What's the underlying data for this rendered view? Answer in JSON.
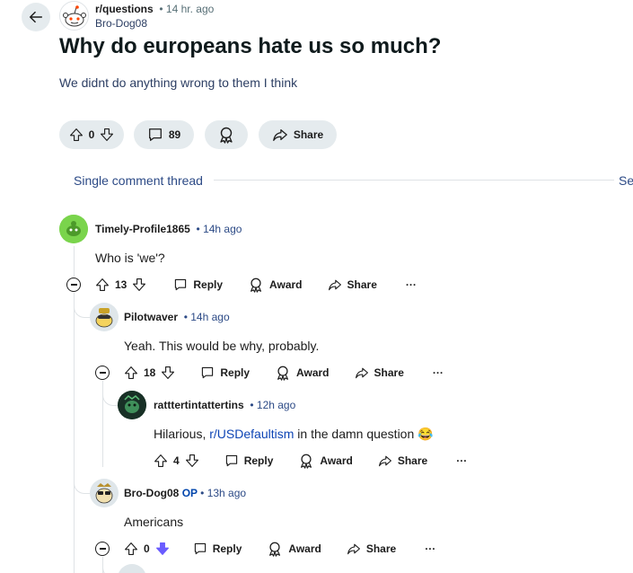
{
  "post": {
    "subreddit": "r/questions",
    "time": "14 hr. ago",
    "author": "Bro-Dog08",
    "title": "Why do europeans hate us so much?",
    "body": "We didnt do anything wrong to them I think",
    "score": "0",
    "comments_count": "89",
    "share_label": "Share"
  },
  "thread": {
    "label": "Single comment thread",
    "see_label": "Se"
  },
  "comments": [
    {
      "author": "Timely-Profile1865",
      "time": "14h ago",
      "text": "Who is 'we'?",
      "score": "13",
      "reply": "Reply",
      "award": "Award",
      "share": "Share",
      "more": "···"
    },
    {
      "author": "Pilotwaver",
      "time": "14h ago",
      "text": "Yeah. This would be why, probably.",
      "score": "18",
      "reply": "Reply",
      "award": "Award",
      "share": "Share",
      "more": "···"
    },
    {
      "author": "ratttertintattertins",
      "time": "12h ago",
      "text_before": "Hilarious, ",
      "link": "r/USDefaultism",
      "text_after": " in the damn question 😂",
      "score": "4",
      "reply": "Reply",
      "award": "Award",
      "share": "Share",
      "more": "···"
    },
    {
      "author": "Bro-Dog08",
      "op": "OP",
      "time": "13h ago",
      "text": "Americans",
      "score": "0",
      "reply": "Reply",
      "award": "Award",
      "share": "Share",
      "more": "···"
    }
  ],
  "colors": {
    "pill_bg": "#e5ebee",
    "link": "#2c4a86",
    "downvote_active": "#6a5cff"
  }
}
